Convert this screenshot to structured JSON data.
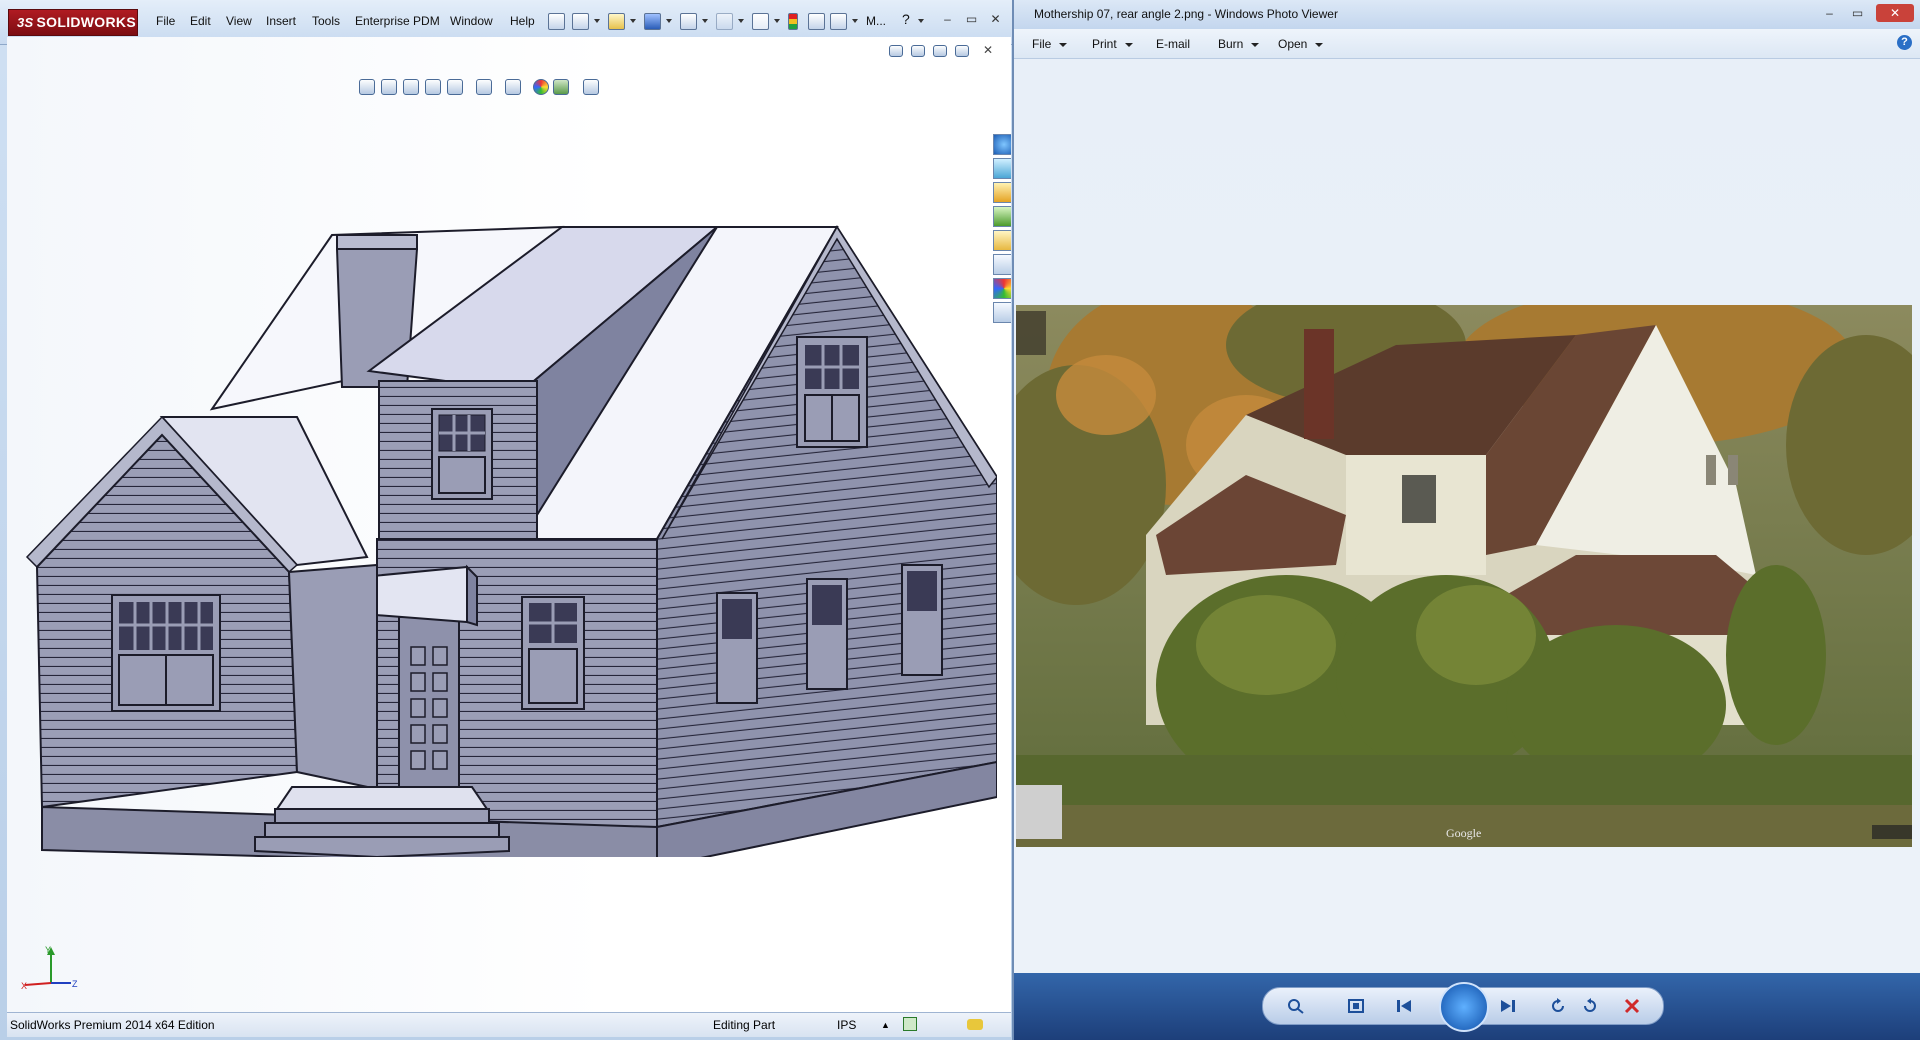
{
  "solidworks": {
    "logo_ds": "3S",
    "logo_text": "SOLIDWORKS",
    "menus": [
      "File",
      "Edit",
      "View",
      "Insert",
      "Tools",
      "Enterprise PDM",
      "Window",
      "Help"
    ],
    "more_label": "M...",
    "status": {
      "edition": "SolidWorks Premium 2014 x64 Edition",
      "mode": "Editing Part",
      "units": "IPS"
    },
    "triad": {
      "x": "X",
      "y": "Y",
      "z": "Z"
    },
    "model_colors": {
      "wall": "#9a9db5",
      "roof": "#f2f3fa",
      "roof_shadow": "#d9dbec",
      "line": "#1c1c2a"
    }
  },
  "photo_viewer": {
    "title": "Mothership 07, rear angle 2.png - Windows Photo Viewer",
    "menus": [
      {
        "label": "File",
        "caret": true
      },
      {
        "label": "Print",
        "caret": true
      },
      {
        "label": "E-mail",
        "caret": false
      },
      {
        "label": "Burn",
        "caret": true
      },
      {
        "label": "Open",
        "caret": true
      }
    ],
    "help_label": "?",
    "photo_watermark": "Google",
    "controls": [
      "zoom-icon",
      "actual-size-icon",
      "previous-icon",
      "slideshow-icon",
      "next-icon",
      "rotate-ccw-icon",
      "rotate-cw-icon",
      "delete-icon"
    ]
  },
  "window_controls": {
    "minimize": "–",
    "maximize": "▭",
    "close": "✕"
  }
}
